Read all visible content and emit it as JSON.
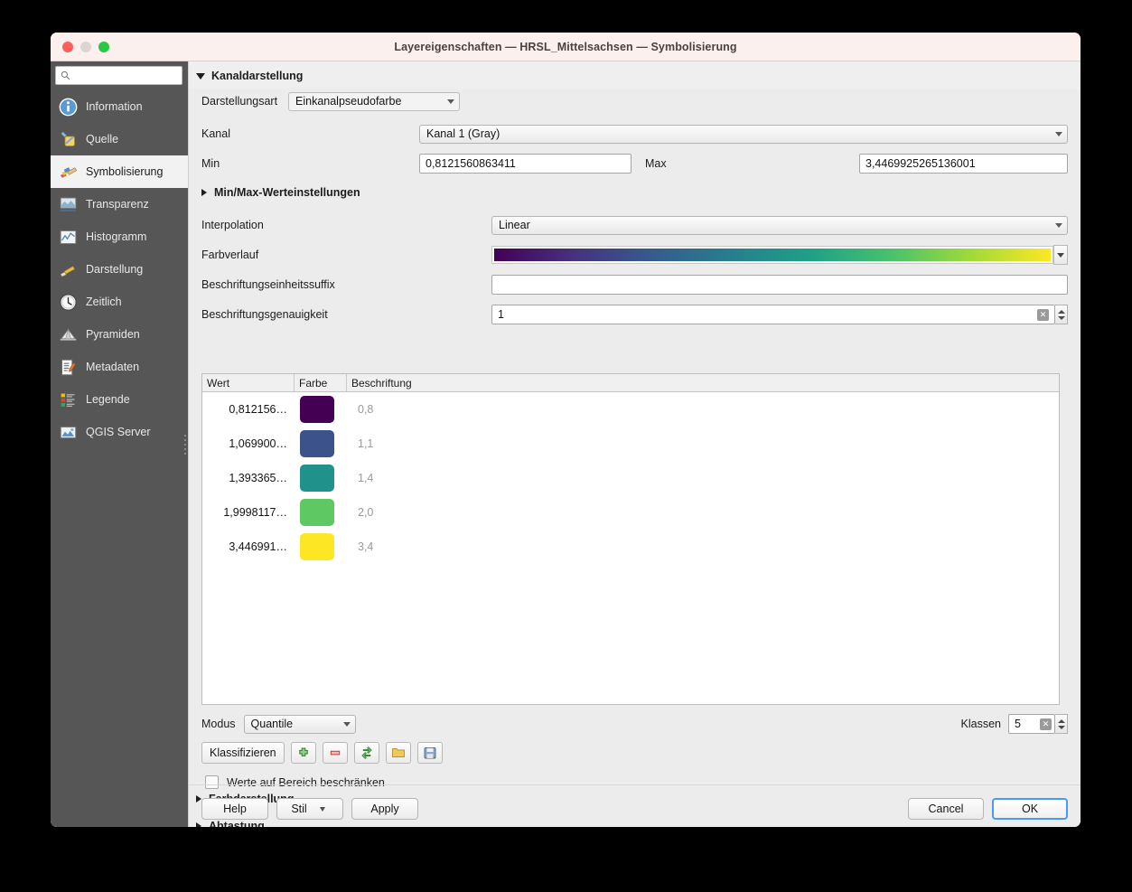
{
  "window": {
    "title": "Layereigenschaften — HRSL_Mittelsachsen — Symbolisierung",
    "traffic_lights": [
      "close-button",
      "minimize-button",
      "maximize-button"
    ]
  },
  "sidebar": {
    "search": {
      "placeholder": "",
      "value": "",
      "icon": "search-icon"
    },
    "items": [
      {
        "label": "Information",
        "icon": "information-icon",
        "selected": false
      },
      {
        "label": "Quelle",
        "icon": "source-icon",
        "selected": false
      },
      {
        "label": "Symbolisierung",
        "icon": "symbology-brush-icon",
        "selected": true
      },
      {
        "label": "Transparenz",
        "icon": "transparency-icon",
        "selected": false
      },
      {
        "label": "Histogramm",
        "icon": "histogram-icon",
        "selected": false
      },
      {
        "label": "Darstellung",
        "icon": "rendering-brush-icon",
        "selected": false
      },
      {
        "label": "Zeitlich",
        "icon": "clock-icon",
        "selected": false
      },
      {
        "label": "Pyramiden",
        "icon": "pyramids-icon",
        "selected": false
      },
      {
        "label": "Metadaten",
        "icon": "metadata-icon",
        "selected": false
      },
      {
        "label": "Legende",
        "icon": "legend-icon",
        "selected": false
      },
      {
        "label": "QGIS Server",
        "icon": "qgis-server-icon",
        "selected": false
      }
    ]
  },
  "main": {
    "section_title": "Kanaldarstellung",
    "render_type": {
      "label": "Darstellungsart",
      "value": "Einkanalpseudofarbe"
    },
    "band": {
      "label": "Kanal",
      "value": "Kanal 1 (Gray)"
    },
    "min": {
      "label": "Min",
      "value": "0,8121560863411"
    },
    "max": {
      "label": "Max",
      "value": "3,4469925265136001"
    },
    "minmax_settings_label": "Min/Max-Werteinstellungen",
    "interpolation": {
      "label": "Interpolation",
      "value": "Linear"
    },
    "color_ramp": {
      "label": "Farbverlauf",
      "name": "Viridis",
      "stops": [
        "#440154",
        "#46327e",
        "#365c8d",
        "#277f8e",
        "#1fa187",
        "#4ac16d",
        "#a0da39",
        "#fde725"
      ]
    },
    "label_unit_suffix": {
      "label": "Beschriftungseinheitssuffix",
      "value": ""
    },
    "label_precision": {
      "label": "Beschriftungsgenauigkeit",
      "value": "1"
    },
    "table": {
      "columns": [
        "Wert",
        "Farbe",
        "Beschriftung"
      ],
      "rows": [
        {
          "value": "0,812156…",
          "color": "#440154",
          "label": "0,8"
        },
        {
          "value": "1,069900…",
          "color": "#3b528b",
          "label": "1,1"
        },
        {
          "value": "1,393365…",
          "color": "#21918c",
          "label": "1,4"
        },
        {
          "value": "1,9998117…",
          "color": "#5ec962",
          "label": "2,0"
        },
        {
          "value": "3,446991…",
          "color": "#fde725",
          "label": "3,4"
        }
      ]
    },
    "mode": {
      "label": "Modus",
      "value": "Quantile"
    },
    "classes": {
      "label": "Klassen",
      "value": "5"
    },
    "classify_button": "Klassifizieren",
    "toolbuttons": [
      {
        "name": "add-entry-button",
        "icon": "plus-icon"
      },
      {
        "name": "remove-entry-button",
        "icon": "minus-icon"
      },
      {
        "name": "sort-entries-button",
        "icon": "arrows-swap-icon"
      },
      {
        "name": "load-colormap-button",
        "icon": "folder-icon"
      },
      {
        "name": "save-colormap-button",
        "icon": "save-disk-icon"
      }
    ],
    "clip_checkbox": {
      "label": "Werte auf Bereich beschränken",
      "checked": false
    },
    "collapsed_sections": [
      "Farbdarstellung",
      "Abtastung"
    ]
  },
  "footer": {
    "help": "Help",
    "style": "Stil",
    "apply": "Apply",
    "cancel": "Cancel",
    "ok": "OK"
  }
}
